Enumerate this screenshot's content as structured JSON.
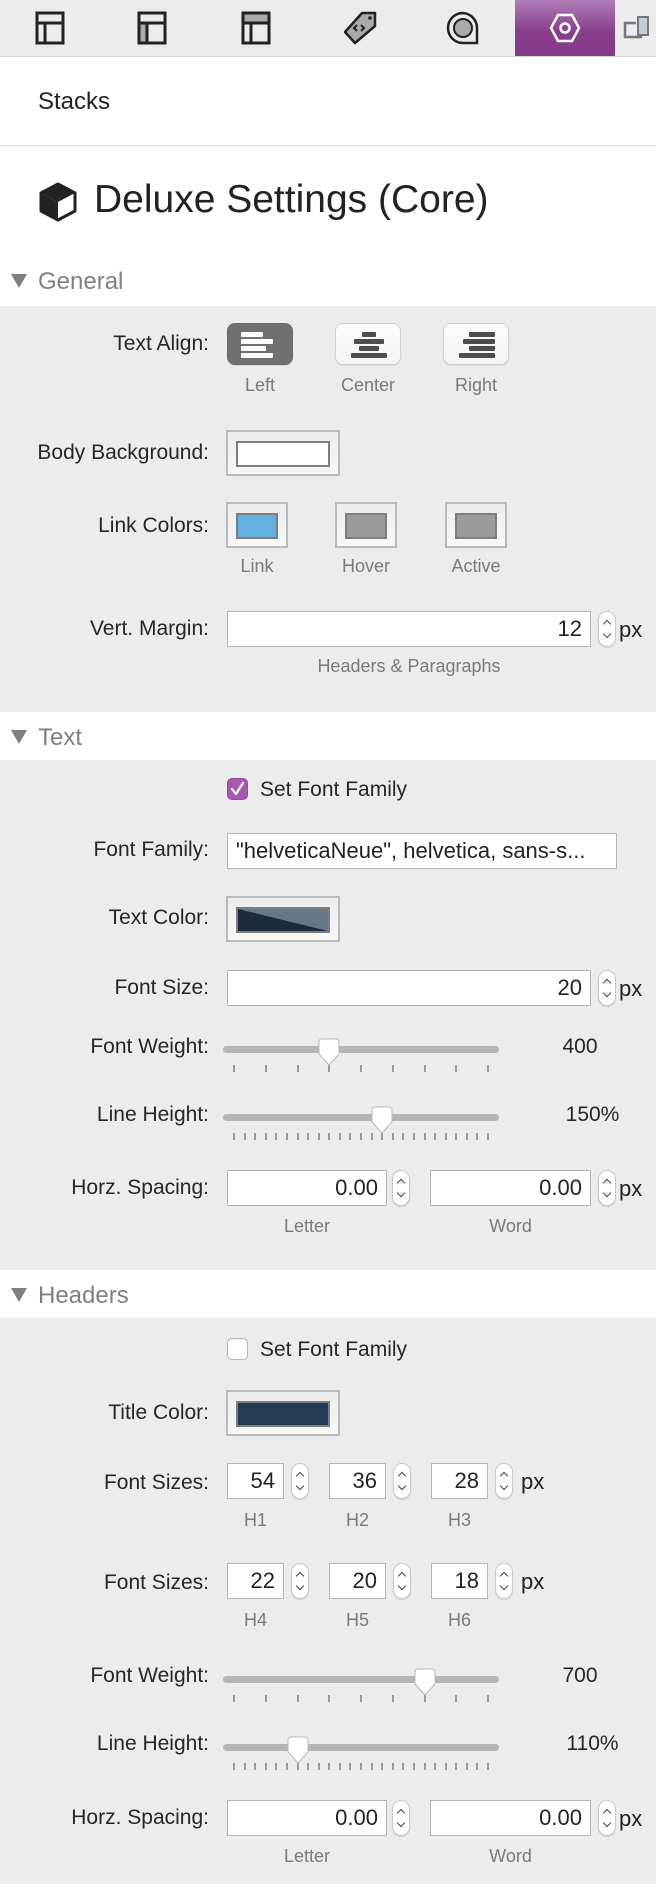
{
  "toolbar": {
    "tabs": [
      {
        "icon": "layout-page-icon",
        "active": false
      },
      {
        "icon": "layout-sidebar-icon",
        "active": false
      },
      {
        "icon": "layout-header-icon",
        "active": false
      },
      {
        "icon": "tag-code-icon",
        "active": false
      },
      {
        "icon": "circle-badge-icon",
        "active": false
      },
      {
        "icon": "hexagon-settings-icon",
        "active": true
      },
      {
        "icon": "devices-icon",
        "active": false
      }
    ],
    "active_color": "#8a3f8e"
  },
  "header": {
    "stacks_label": "Stacks",
    "title": "Deluxe Settings (Core)",
    "title_icon": "cube-icon"
  },
  "sections": {
    "general": {
      "label": "General",
      "text_align": {
        "label": "Text Align:",
        "options": [
          "Left",
          "Center",
          "Right"
        ],
        "selected": "Left"
      },
      "body_background": {
        "label": "Body Background:",
        "color": "#ffffff"
      },
      "link_colors": {
        "label": "Link Colors:",
        "items": [
          {
            "label": "Link",
            "color": "#62b1e0"
          },
          {
            "label": "Hover",
            "color": "#9b9b9b"
          },
          {
            "label": "Active",
            "color": "#9b9b9b"
          }
        ]
      },
      "vert_margin": {
        "label": "Vert. Margin:",
        "value": "12",
        "unit": "px",
        "caption": "Headers & Paragraphs"
      }
    },
    "text": {
      "label": "Text",
      "set_font_family": {
        "label": "Set Font Family",
        "checked": true
      },
      "font_family": {
        "label": "Font Family:",
        "value": "\"helveticaNeue\", helvetica, sans-s..."
      },
      "text_color": {
        "label": "Text Color:",
        "color_dark": "#1c2b3c",
        "color_light": "#667788"
      },
      "font_size": {
        "label": "Font Size:",
        "value": "20",
        "unit": "px"
      },
      "font_weight": {
        "label": "Font Weight:",
        "value": "400",
        "min": 100,
        "max": 900,
        "step": 100
      },
      "line_height": {
        "label": "Line Height:",
        "value": "150%",
        "numeric": 150,
        "min": 80,
        "max": 200,
        "step": 5
      },
      "horz_spacing": {
        "label": "Horz. Spacing:",
        "letter": "0.00",
        "word": "0.00",
        "letter_caption": "Letter",
        "word_caption": "Word",
        "unit": "px"
      }
    },
    "headers": {
      "label": "Headers",
      "set_font_family": {
        "label": "Set Font Family",
        "checked": false
      },
      "title_color": {
        "label": "Title Color:",
        "color": "#243b55"
      },
      "font_sizes_row1": {
        "label": "Font Sizes:",
        "unit": "px",
        "items": [
          {
            "value": "54",
            "caption": "H1"
          },
          {
            "value": "36",
            "caption": "H2"
          },
          {
            "value": "28",
            "caption": "H3"
          }
        ]
      },
      "font_sizes_row2": {
        "label": "Font Sizes:",
        "unit": "px",
        "items": [
          {
            "value": "22",
            "caption": "H4"
          },
          {
            "value": "20",
            "caption": "H5"
          },
          {
            "value": "18",
            "caption": "H6"
          }
        ]
      },
      "font_weight": {
        "label": "Font Weight:",
        "value": "700",
        "min": 100,
        "max": 900,
        "step": 100
      },
      "line_height": {
        "label": "Line Height:",
        "value": "110%",
        "numeric": 110,
        "min": 80,
        "max": 200,
        "step": 5
      },
      "horz_spacing": {
        "label": "Horz. Spacing:",
        "letter": "0.00",
        "word": "0.00",
        "letter_caption": "Letter",
        "word_caption": "Word",
        "unit": "px"
      }
    }
  }
}
